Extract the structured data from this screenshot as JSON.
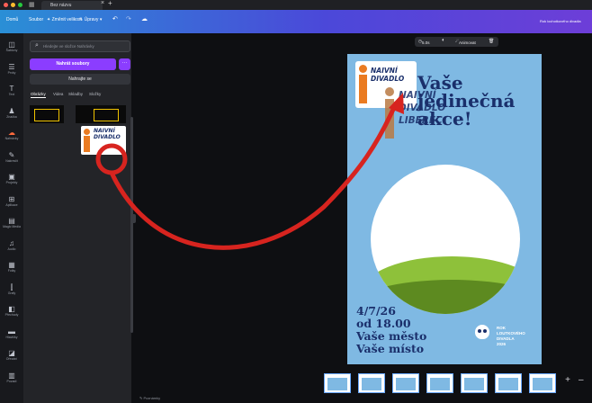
{
  "browser": {
    "tab_title": "Bez názvu",
    "colors": [
      "#ff5f56",
      "#ffbd2e",
      "#27c93f"
    ]
  },
  "toolbar": {
    "home": "Domů",
    "file": "Soubor",
    "resize": "Změnit velikost",
    "editing": "Úpravy",
    "undo_icon": "undo-icon",
    "redo_icon": "redo-icon",
    "save_icon": "cloud-icon",
    "doc_title": "Rok lochotkového divadla"
  },
  "rail": [
    {
      "icon": "◫",
      "label": "Šablony"
    },
    {
      "icon": "☰",
      "label": "Prvky"
    },
    {
      "icon": "T",
      "label": "Text"
    },
    {
      "icon": "♟",
      "label": "Značka"
    },
    {
      "icon": "☁",
      "label": "Nahrávky"
    },
    {
      "icon": "✎",
      "label": "Nakreslit"
    },
    {
      "icon": "▣",
      "label": "Projekty"
    },
    {
      "icon": "⊞",
      "label": "Aplikace"
    },
    {
      "icon": "▤",
      "label": "Magic Media"
    },
    {
      "icon": "♫",
      "label": "Audio"
    },
    {
      "icon": "▦",
      "label": "Fotky"
    },
    {
      "icon": "⫿",
      "label": "Grafy"
    },
    {
      "icon": "◧",
      "label": "Přechody"
    },
    {
      "icon": "▬",
      "label": "Hlavičky"
    },
    {
      "icon": "◪",
      "label": "Ořezání"
    },
    {
      "icon": "▥",
      "label": "Pozadí"
    }
  ],
  "panel": {
    "search_placeholder": "Hledejte ve složce Nahrávky",
    "upload_button": "Nahrát soubory",
    "more_button": "···",
    "record_button": "Nahrajte se",
    "tabs": [
      "Obrázky",
      "Videa",
      "Skladby",
      "Složky"
    ],
    "thumb_text": "NAIVNÍ DIVADLO"
  },
  "canvas_toolbar": {
    "timer": "5.0s",
    "animate": "Animovat",
    "delete_icon": "trash-icon"
  },
  "poster": {
    "title_lines": [
      "Vaše",
      "jedinečná",
      "akce!"
    ],
    "logo_lines": [
      "NAIVNÍ",
      "DIVADLO",
      "LIBEREC"
    ],
    "date_lines": [
      "4/7/26",
      "od 18.00",
      "Vaše město",
      "Vaše místo"
    ],
    "org_lines": [
      "ROK",
      "LOUTKOVÉHO",
      "DIVADLA",
      "2026"
    ],
    "brand_blue": "#1a2f6b",
    "sky": "#7fb9e3",
    "logo_orange": "#ea7b21"
  },
  "pages": {
    "count": 7,
    "add_label": "+",
    "zoom_out": "–"
  },
  "status": {
    "notes": "Poznámky"
  },
  "annotation": {
    "color": "#d7241f"
  }
}
